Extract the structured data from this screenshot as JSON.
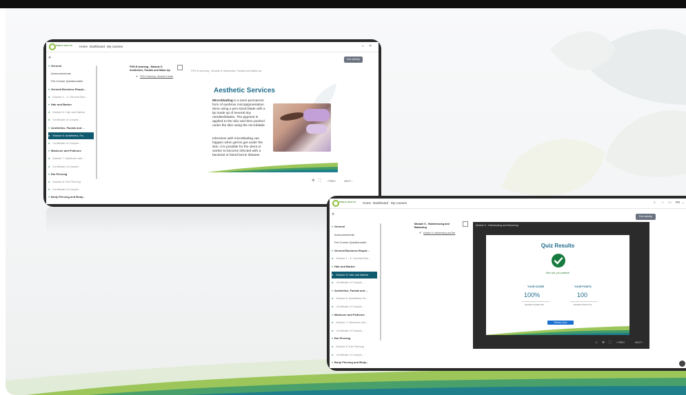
{
  "left_screen": {
    "nav": {
      "home": "Home",
      "dashboard": "Dashboard",
      "my_courses": "My courses"
    },
    "sidebar": [
      {
        "label": "General",
        "kind": "section"
      },
      {
        "label": "Announcements",
        "kind": "item"
      },
      {
        "label": "Pre-Course Questionnaire",
        "kind": "item"
      },
      {
        "label": "General Business Requir...",
        "kind": "section"
      },
      {
        "label": "Module 1 - 4: General Bus...",
        "kind": "dim"
      },
      {
        "label": "Hair and Barber",
        "kind": "section"
      },
      {
        "label": "Module 5: Hair and Barber",
        "kind": "dim"
      },
      {
        "label": "Certificate of Comple...",
        "kind": "dim"
      },
      {
        "label": "Aesthetics, Facials and ...",
        "kind": "section"
      },
      {
        "label": "Module 6: Aesthetics, Fa...",
        "kind": "active"
      },
      {
        "label": "Certificate of Comple...",
        "kind": "dim"
      },
      {
        "label": "Manicure and Pedicure",
        "kind": "section"
      },
      {
        "label": "Module 7: Manicure and ...",
        "kind": "dim"
      },
      {
        "label": "Certificate of Comple...",
        "kind": "dim"
      },
      {
        "label": "Ear Piercing",
        "kind": "section"
      },
      {
        "label": "Module 8: Ear Piercing",
        "kind": "dim"
      },
      {
        "label": "Certificate of Comple...",
        "kind": "dim"
      },
      {
        "label": "Body Piercing and Body...",
        "kind": "section"
      }
    ],
    "activity_title": "PSS E-learning - Module 6: Aesthetics, Facials and Make-Up",
    "activity_done": "PSS E-learning - Module 6 Aesth",
    "breadcrumb": "PSS E-learning - Module 6: Aesthetics, Facials and Make-Up",
    "exit_button": "Exit activity",
    "slide": {
      "title": "Aesthetic Services",
      "para1_bold": "Microblading",
      "para1": " is a semi-permanent form of eyebrow micropigmentation done using a pen-sized blade with a tip made up of several tiny needles/blades. The pigment is applied to the skin and then pushed under the skin using the microblade.",
      "para2": "Infections with microblading can happen when germs get under the skin. It is possible for the client or worker to become infected with a bacterial or blood borne disease."
    },
    "controls": {
      "prev": "PREV",
      "next": "NEXT"
    }
  },
  "right_screen": {
    "nav": {
      "home": "Home",
      "dashboard": "Dashboard",
      "my_courses": "My courses",
      "user": "PH"
    },
    "sidebar": [
      {
        "label": "General",
        "kind": "section"
      },
      {
        "label": "Announcements",
        "kind": "item"
      },
      {
        "label": "Pre-Course Questionnaire",
        "kind": "item"
      },
      {
        "label": "General Business Requir...",
        "kind": "section"
      },
      {
        "label": "Module 1 - 4: General Bus...",
        "kind": "dim"
      },
      {
        "label": "Hair and Barber",
        "kind": "section"
      },
      {
        "label": "Module 5: Hair and Barber",
        "kind": "active"
      },
      {
        "label": "Certificate of Comple...",
        "kind": "dim"
      },
      {
        "label": "Aesthetics, Facials and ...",
        "kind": "section"
      },
      {
        "label": "Module 6: Aesthetics Fa...",
        "kind": "dim"
      },
      {
        "label": "Certificate of Comple...",
        "kind": "dim"
      },
      {
        "label": "Manicure and Pedicure",
        "kind": "section"
      },
      {
        "label": "Module 7: Manicure and...",
        "kind": "dim"
      },
      {
        "label": "Certificate of Comple...",
        "kind": "dim"
      },
      {
        "label": "Ear Piercing",
        "kind": "section"
      },
      {
        "label": "Module 8: Ear Piercing",
        "kind": "dim"
      },
      {
        "label": "Certificate of Comple...",
        "kind": "dim"
      },
      {
        "label": "Body Piercing and Body...",
        "kind": "section"
      }
    ],
    "activity_title": "Module 5 - Hairdressing and Barbering",
    "activity_done": "Module 5: Hairdressing and Bar",
    "panel_title": "Module 5 - Hairdressing and Barbering",
    "exit_button": "Exit activity",
    "quiz": {
      "title": "Quiz Results",
      "message": "Nice job, you passed!",
      "your_score_label": "YOUR SCORE",
      "your_score": "100%",
      "passing_score": "PASSING SCORE: 80%",
      "your_points_label": "YOUR POINTS",
      "your_points": "100",
      "passing_points": "PASSING POINTS: 80",
      "review_button": "Review Quiz"
    },
    "controls": {
      "prev": "PREV",
      "next": "NEXT"
    }
  },
  "colors": {
    "accent_teal": "#0f5a6e",
    "title_blue": "#1e6b8a",
    "brand_green": "#8dbf3a",
    "success_green": "#177a3e",
    "review_blue": "#1b6fd1"
  },
  "icons": [
    "search-icon",
    "close-icon",
    "fullscreen-icon",
    "settings-icon",
    "volume-icon",
    "check-icon",
    "bell-icon",
    "chat-icon",
    "chevron-down-icon"
  ]
}
